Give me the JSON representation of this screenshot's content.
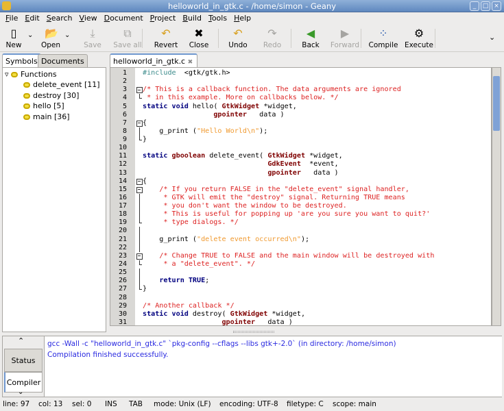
{
  "window": {
    "title": "helloworld_in_gtk.c - /home/simon - Geany",
    "buttons": [
      "_",
      "□",
      "×"
    ]
  },
  "menu": [
    "File",
    "Edit",
    "Search",
    "View",
    "Document",
    "Project",
    "Build",
    "Tools",
    "Help"
  ],
  "toolbar": [
    {
      "label": "New",
      "icon": "new-file-icon",
      "glyph": "▯",
      "enabled": true,
      "dropdown": true
    },
    {
      "label": "Open",
      "icon": "folder-open-icon",
      "glyph": "📂",
      "enabled": true,
      "dropdown": true
    },
    {
      "label": "Save",
      "icon": "save-icon",
      "glyph": "⤓",
      "enabled": false
    },
    {
      "label": "Save all",
      "icon": "save-all-icon",
      "glyph": "⧉",
      "enabled": false
    },
    {
      "label": "Revert",
      "icon": "revert-icon",
      "glyph": "↶",
      "enabled": true
    },
    {
      "label": "Close",
      "icon": "close-icon",
      "glyph": "✖",
      "enabled": true
    },
    {
      "label": "Undo",
      "icon": "undo-icon",
      "glyph": "↶",
      "enabled": true
    },
    {
      "label": "Redo",
      "icon": "redo-icon",
      "glyph": "↷",
      "enabled": false
    },
    {
      "label": "Back",
      "icon": "back-arrow-icon",
      "glyph": "◀",
      "enabled": true
    },
    {
      "label": "Forward",
      "icon": "forward-arrow-icon",
      "glyph": "▶",
      "enabled": false
    },
    {
      "label": "Compile",
      "icon": "compile-icon",
      "glyph": "⁘",
      "enabled": true
    },
    {
      "label": "Execute",
      "icon": "execute-gears-icon",
      "glyph": "⚙",
      "enabled": true
    }
  ],
  "sidebar": {
    "tabs": [
      "Symbols",
      "Documents"
    ],
    "active_tab": "Symbols",
    "root": "Functions",
    "items": [
      "delete_event [11]",
      "destroy [30]",
      "hello [5]",
      "main [36]"
    ]
  },
  "editor": {
    "tab": "helloworld_in_gtk.c",
    "close_glyph": "✖",
    "lines": [
      {
        "n": "1",
        "t": [
          [
            "pre",
            "#include"
          ],
          [
            "",
            "  <gtk/gtk.h>"
          ]
        ]
      },
      {
        "n": "2",
        "t": []
      },
      {
        "n": "3",
        "f": "start",
        "t": [
          [
            "cm",
            "/* This is a callback function. The data arguments are ignored"
          ]
        ]
      },
      {
        "n": "4",
        "f": "end",
        "t": [
          [
            "cm",
            " * in this example. More on callbacks below. */"
          ]
        ]
      },
      {
        "n": "5",
        "t": [
          [
            "kw",
            "static void"
          ],
          [
            "",
            " hello( "
          ],
          [
            "type",
            "GtkWidget"
          ],
          [
            "",
            " *widget,"
          ]
        ]
      },
      {
        "n": "6",
        "t": [
          [
            "",
            "                 "
          ],
          [
            "type",
            "gpointer"
          ],
          [
            "",
            "   data )"
          ]
        ]
      },
      {
        "n": "7",
        "f": "start",
        "t": [
          [
            "",
            "{"
          ]
        ]
      },
      {
        "n": "8",
        "f": "mid",
        "t": [
          [
            "",
            "    g_print ("
          ],
          [
            "str",
            "\"Hello World\\n\""
          ],
          [
            "",
            ");"
          ]
        ]
      },
      {
        "n": "9",
        "f": "end",
        "t": [
          [
            "",
            "}"
          ]
        ]
      },
      {
        "n": "10",
        "t": []
      },
      {
        "n": "11",
        "t": [
          [
            "kw",
            "static"
          ],
          [
            "",
            " "
          ],
          [
            "type",
            "gboolean"
          ],
          [
            "",
            " delete_event( "
          ],
          [
            "type",
            "GtkWidget"
          ],
          [
            "",
            " *widget,"
          ]
        ]
      },
      {
        "n": "12",
        "t": [
          [
            "",
            "                              "
          ],
          [
            "type",
            "GdkEvent"
          ],
          [
            "",
            "  *event,"
          ]
        ]
      },
      {
        "n": "13",
        "t": [
          [
            "",
            "                              "
          ],
          [
            "type",
            "gpointer"
          ],
          [
            "",
            "   data )"
          ]
        ]
      },
      {
        "n": "14",
        "f": "start",
        "t": [
          [
            "",
            "{"
          ]
        ]
      },
      {
        "n": "15",
        "f": "start",
        "t": [
          [
            "",
            "    "
          ],
          [
            "cm",
            "/* If you return FALSE in the \"delete_event\" signal handler,"
          ]
        ]
      },
      {
        "n": "16",
        "f": "mid",
        "t": [
          [
            "cm",
            "     * GTK will emit the \"destroy\" signal. Returning TRUE means"
          ]
        ]
      },
      {
        "n": "17",
        "f": "mid",
        "t": [
          [
            "cm",
            "     * you don't want the window to be destroyed."
          ]
        ]
      },
      {
        "n": "18",
        "f": "mid",
        "t": [
          [
            "cm",
            "     * This is useful for popping up 'are you sure you want to quit?'"
          ]
        ]
      },
      {
        "n": "19",
        "f": "end",
        "t": [
          [
            "cm",
            "     * type dialogs. */"
          ]
        ]
      },
      {
        "n": "20",
        "f": "mid",
        "t": []
      },
      {
        "n": "21",
        "f": "mid",
        "t": [
          [
            "",
            "    g_print ("
          ],
          [
            "str",
            "\"delete event occurred\\n\""
          ],
          [
            "",
            ");"
          ]
        ]
      },
      {
        "n": "22",
        "f": "mid",
        "t": []
      },
      {
        "n": "23",
        "f": "start",
        "t": [
          [
            "",
            "    "
          ],
          [
            "cm",
            "/* Change TRUE to FALSE and the main window will be destroyed with"
          ]
        ]
      },
      {
        "n": "24",
        "f": "end",
        "t": [
          [
            "cm",
            "     * a \"delete_event\". */"
          ]
        ]
      },
      {
        "n": "25",
        "f": "mid",
        "t": []
      },
      {
        "n": "26",
        "f": "mid",
        "t": [
          [
            "",
            "    "
          ],
          [
            "kw",
            "return TRUE"
          ],
          [
            "",
            ";"
          ]
        ]
      },
      {
        "n": "27",
        "f": "end",
        "t": [
          [
            "",
            "}"
          ]
        ]
      },
      {
        "n": "28",
        "t": []
      },
      {
        "n": "29",
        "t": [
          [
            "cm",
            "/* Another callback */"
          ]
        ]
      },
      {
        "n": "30",
        "t": [
          [
            "kw",
            "static void"
          ],
          [
            "",
            " destroy( "
          ],
          [
            "type",
            "GtkWidget"
          ],
          [
            "",
            " *widget,"
          ]
        ]
      },
      {
        "n": "31",
        "t": [
          [
            "",
            "                   "
          ],
          [
            "type",
            "gpointer"
          ],
          [
            "",
            "   data )"
          ]
        ]
      }
    ]
  },
  "messages": {
    "tabs": [
      "Status",
      "Compiler"
    ],
    "active_tab": "Compiler",
    "lines": [
      "gcc -Wall -c \"helloworld_in_gtk.c\" `pkg-config --cflags --libs gtk+-2.0` (in directory: /home/simon)",
      "Compilation finished successfully."
    ]
  },
  "status": {
    "line": "line: 97",
    "col": "col: 13",
    "sel": "sel: 0",
    "ins": "INS",
    "tab": "TAB",
    "mode": "mode: Unix (LF)",
    "encoding": "encoding: UTF-8",
    "filetype": "filetype: C",
    "scope": "scope: main"
  },
  "colors": {
    "accent": "#6f97cf",
    "comment": "#dd2222",
    "keyword": "#00007f",
    "type": "#7f0000",
    "string": "#f09a30",
    "messages": "#2a2ae0"
  }
}
